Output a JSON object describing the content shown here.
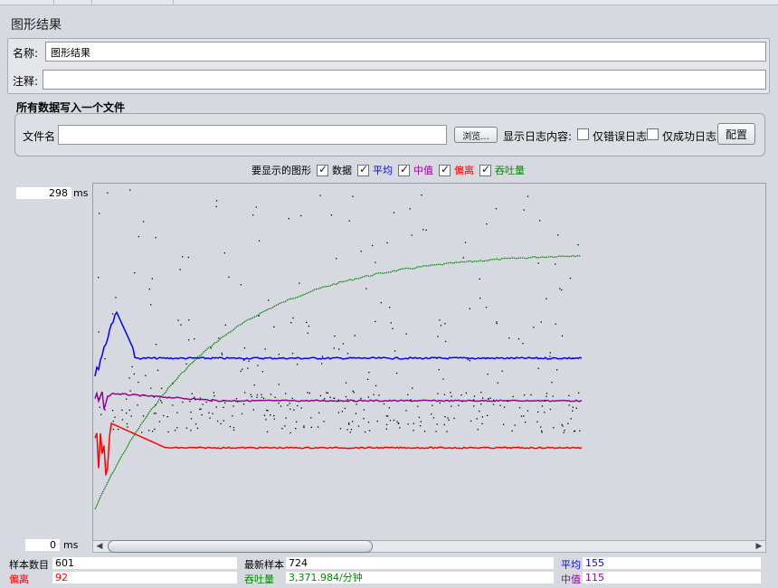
{
  "panel": {
    "title": "图形结果"
  },
  "name_field": {
    "label": "名称:",
    "value": "图形结果"
  },
  "comment_field": {
    "label": "注释:",
    "value": ""
  },
  "file_section": {
    "title": "所有数据写入一个文件",
    "file_label": "文件名",
    "file_value": "",
    "browse_label": "浏览...",
    "log_label": "显示日志内容:",
    "errors_only_label": "仅错误日志",
    "success_only_label": "仅成功日志",
    "config_label": "配置"
  },
  "legend": {
    "title": "要显示的图形",
    "items": [
      {
        "label": "数据",
        "color": "#000000",
        "checked": true
      },
      {
        "label": "平均",
        "color": "#0000ff",
        "checked": true
      },
      {
        "label": "中值",
        "color": "#990099",
        "checked": true
      },
      {
        "label": "偏离",
        "color": "#ff0000",
        "checked": true
      },
      {
        "label": "吞吐量",
        "color": "#008800",
        "checked": true
      }
    ]
  },
  "y_axis": {
    "max": "298",
    "min": "0",
    "unit": "ms"
  },
  "stats": {
    "samples_label": "样本数目",
    "samples_value": "601",
    "latest_label": "最新样本",
    "latest_value": "724",
    "average_label": "平均",
    "average_value": "155",
    "deviation_label": "偏离",
    "deviation_value": "92",
    "throughput_label": "吞吐量",
    "throughput_value": "3,371.984/分钟",
    "median_label": "中值",
    "median_value": "115"
  },
  "chart_data": {
    "type": "scatter",
    "ylim": [
      0,
      298
    ],
    "series": [
      {
        "name": "平均",
        "color": "#0000ff"
      },
      {
        "name": "中值",
        "color": "#990099"
      },
      {
        "name": "偏离",
        "color": "#ff0000"
      },
      {
        "name": "吞吐量",
        "color": "#008800"
      },
      {
        "name": "数据",
        "color": "#000000"
      }
    ]
  }
}
